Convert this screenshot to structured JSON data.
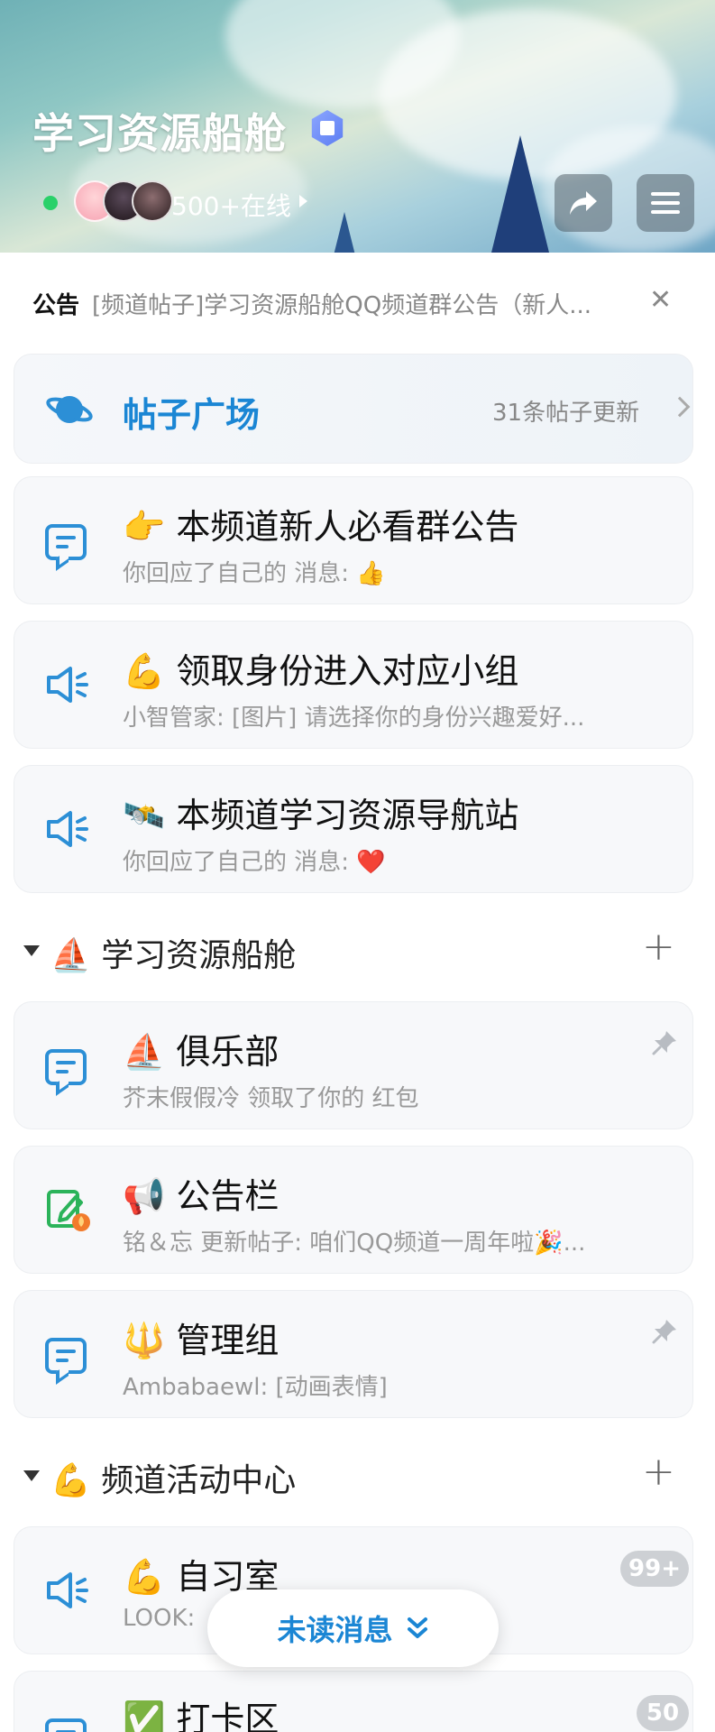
{
  "header": {
    "title": "学习资源船舱",
    "online_text": "500+在线"
  },
  "notice": {
    "label": "公告",
    "text": "[频道帖子]学习资源船舱QQ频道群公告（新人..."
  },
  "plaza": {
    "name": "帖子广场",
    "count": "31条帖子更新"
  },
  "top_channels": [
    {
      "emoji": "👉",
      "name": "本频道新人必看群公告",
      "sub": "你回应了自己的 消息: 👍",
      "icon": "chat-icon"
    },
    {
      "emoji": "💪",
      "name": "领取身份进入对应小组",
      "sub": "小智管家: [图片]  请选择你的身份兴趣爱好...",
      "icon": "speaker-icon"
    },
    {
      "emoji": "🛰️",
      "name": "本频道学习资源导航站",
      "sub": "你回应了自己的 消息: ❤️",
      "icon": "speaker-icon"
    }
  ],
  "groups": [
    {
      "emoji": "⛵",
      "name": "学习资源船舱",
      "channels": [
        {
          "emoji": "⛵",
          "name": "俱乐部",
          "sub": "芥末假假冷 领取了你的 红包",
          "icon": "chat-icon",
          "pinned": true
        },
        {
          "emoji": "📢",
          "name": "公告栏",
          "sub": "铭＆忘 更新帖子: 咱们QQ频道一周年啦🎉...",
          "icon": "edit-icon",
          "pinned": false
        },
        {
          "emoji": "🔱",
          "name": "管理组",
          "sub": "Ambabaewl: [动画表情]",
          "icon": "chat-icon",
          "pinned": true
        }
      ]
    },
    {
      "emoji": "💪",
      "name": "频道活动中心",
      "channels": [
        {
          "emoji": "💪",
          "name": "自习室",
          "sub": "LOOK:",
          "icon": "speaker-icon",
          "badge": "99+"
        },
        {
          "emoji": "✅",
          "name": "打卡区",
          "sub": "",
          "icon": "chat-icon",
          "badge": "50"
        }
      ]
    }
  ],
  "unread_button": {
    "label": "未读消息"
  },
  "colors": {
    "accent": "#1b86d4",
    "online": "#29d16a",
    "icon_blue": "#2c8fd6",
    "icon_green": "#2bb35a"
  }
}
